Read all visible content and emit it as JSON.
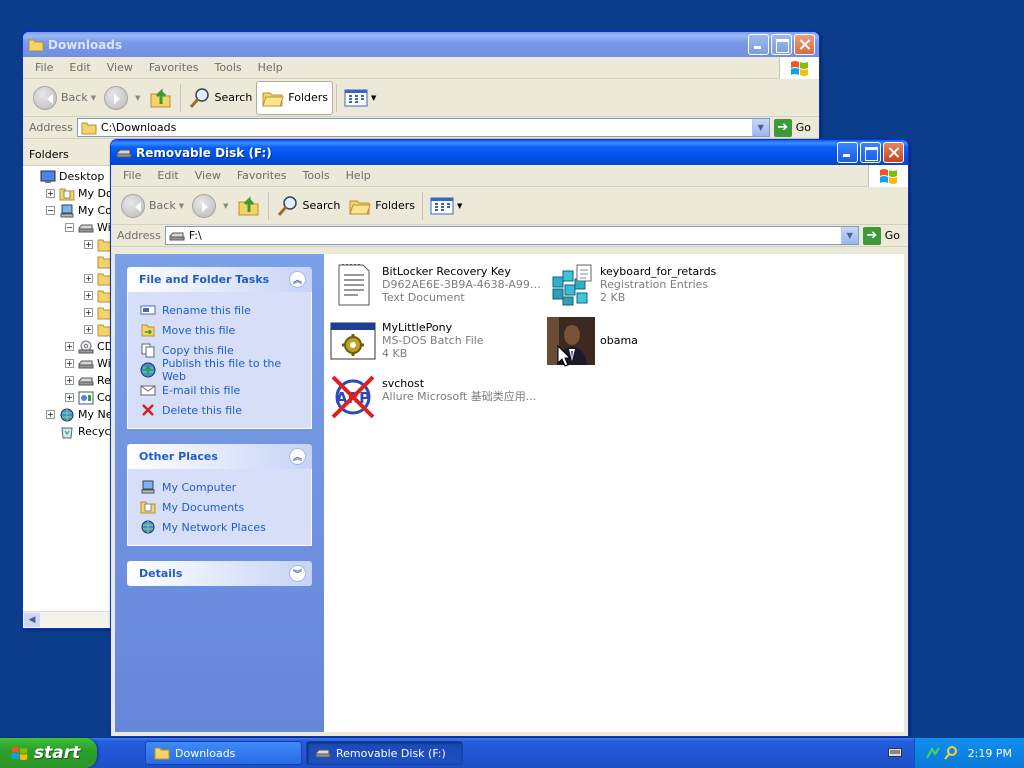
{
  "windows": {
    "downloads": {
      "title": "Downloads",
      "menu": [
        "File",
        "Edit",
        "View",
        "Favorites",
        "Tools",
        "Help"
      ],
      "toolbar": {
        "back": "Back",
        "search": "Search",
        "folders": "Folders"
      },
      "address_label": "Address",
      "address_value": "C:\\Downloads",
      "go_label": "Go",
      "folders_header": "Folders",
      "tree": [
        {
          "label": "Desktop",
          "expander": "",
          "indent": 0,
          "icon": "desktop-icon"
        },
        {
          "label": "My Docu",
          "expander": "+",
          "indent": 1,
          "icon": "my-documents-icon"
        },
        {
          "label": "My Comp",
          "expander": "-",
          "indent": 1,
          "icon": "my-computer-icon"
        },
        {
          "label": "Wind",
          "expander": "-",
          "indent": 2,
          "icon": "drive-icon"
        },
        {
          "label": "D",
          "expander": "+",
          "indent": 3,
          "icon": "folder-icon"
        },
        {
          "label": "D",
          "expander": "",
          "indent": 3,
          "icon": "folder-icon"
        },
        {
          "label": "P",
          "expander": "+",
          "indent": 3,
          "icon": "folder-icon"
        },
        {
          "label": "V",
          "expander": "+",
          "indent": 3,
          "icon": "folder-icon"
        },
        {
          "label": "V",
          "expander": "+",
          "indent": 3,
          "icon": "folder-icon"
        },
        {
          "label": "V",
          "expander": "+",
          "indent": 3,
          "icon": "folder-icon"
        },
        {
          "label": "CD D",
          "expander": "+",
          "indent": 2,
          "icon": "cd-drive-icon"
        },
        {
          "label": "Wind",
          "expander": "+",
          "indent": 2,
          "icon": "drive-icon"
        },
        {
          "label": "Remo",
          "expander": "+",
          "indent": 2,
          "icon": "removable-drive-icon"
        },
        {
          "label": "Cont",
          "expander": "+",
          "indent": 2,
          "icon": "control-panel-icon"
        },
        {
          "label": "My Netw",
          "expander": "+",
          "indent": 1,
          "icon": "my-network-icon"
        },
        {
          "label": "Recycle B",
          "expander": "",
          "indent": 1,
          "icon": "recycle-bin-icon"
        }
      ]
    },
    "removable": {
      "title": "Removable Disk (F:)",
      "menu": [
        "File",
        "Edit",
        "View",
        "Favorites",
        "Tools",
        "Help"
      ],
      "toolbar": {
        "back": "Back",
        "search": "Search",
        "folders": "Folders"
      },
      "address_label": "Address",
      "address_value": "F:\\",
      "go_label": "Go",
      "file_tasks": {
        "title": "File and Folder Tasks",
        "items": [
          {
            "label": "Rename this file",
            "icon": "rename-icon"
          },
          {
            "label": "Move this file",
            "icon": "move-icon"
          },
          {
            "label": "Copy this file",
            "icon": "copy-icon"
          },
          {
            "label": "Publish this file to the Web",
            "icon": "publish-web-icon"
          },
          {
            "label": "E-mail this file",
            "icon": "email-icon"
          },
          {
            "label": "Delete this file",
            "icon": "delete-icon"
          }
        ]
      },
      "other_places": {
        "title": "Other Places",
        "items": [
          {
            "label": "My Computer",
            "icon": "my-computer-icon"
          },
          {
            "label": "My Documents",
            "icon": "my-documents-icon"
          },
          {
            "label": "My Network Places",
            "icon": "my-network-icon"
          }
        ]
      },
      "details": {
        "title": "Details"
      },
      "files": [
        {
          "name": "BitLocker Recovery Key",
          "sub1": "D962AE6E-3B9A-4638-A995-8...",
          "sub2": "Text Document",
          "icon": "text-document-icon"
        },
        {
          "name": "keyboard_for_retards",
          "sub1": "Registration Entries",
          "sub2": "2 KB",
          "icon": "registry-icon"
        },
        {
          "name": "MyLittlePony",
          "sub1": "MS-DOS Batch File",
          "sub2": "4 KB",
          "icon": "batch-file-icon"
        },
        {
          "name": "obama",
          "sub1": "",
          "sub2": "",
          "icon": "photo-thumbnail-icon"
        },
        {
          "name": "svchost",
          "sub1": "Allure Microsoft 基础类应用...",
          "sub2": "",
          "icon": "executable-icon"
        }
      ]
    }
  },
  "taskbar": {
    "start_label": "start",
    "buttons": [
      "Downloads",
      "Removable Disk (F:)"
    ],
    "clock": "2:19 PM"
  },
  "colors": {
    "desktop": "#0b3d8c",
    "accent": "#0a5ef6",
    "task_link": "#215dc6"
  }
}
